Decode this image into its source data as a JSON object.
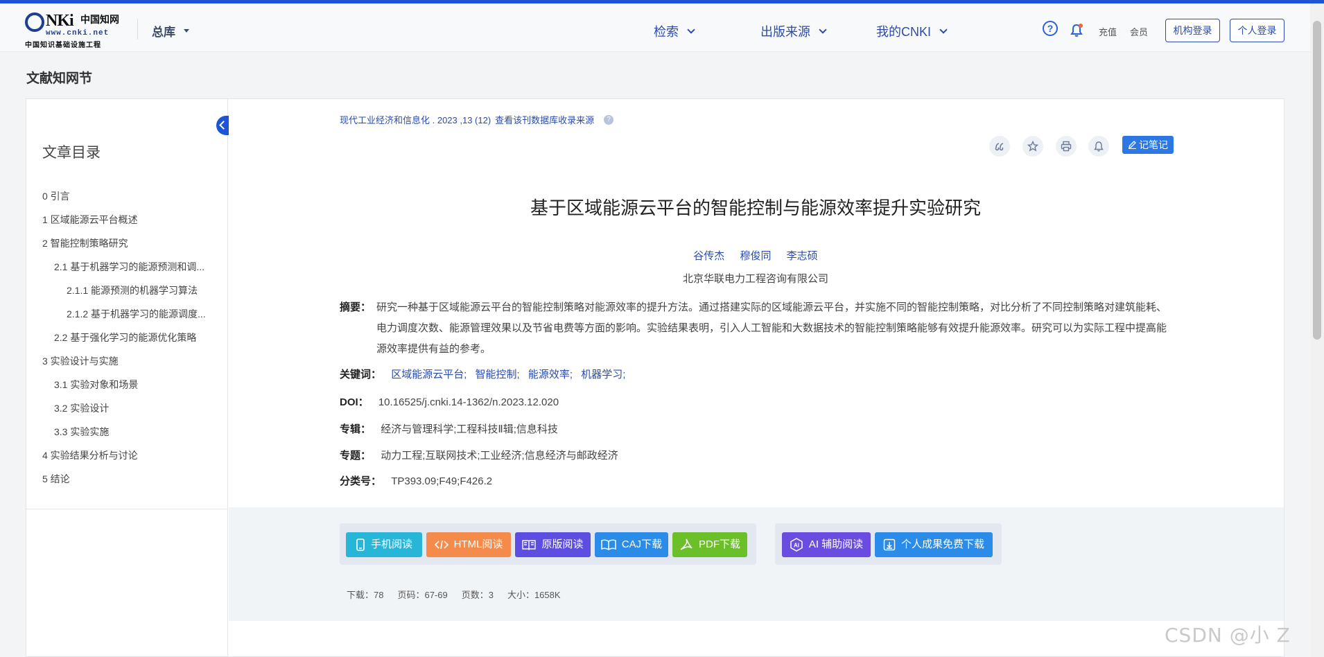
{
  "header": {
    "logo_text": "CNKi",
    "logo_cn": "中国知网",
    "logo_url": "www.cnki.net",
    "logo_sub": "中国知识基础设施工程",
    "db_select": "总库",
    "nav": [
      "检索",
      "出版来源",
      "我的CNKI"
    ],
    "help_icon": "?",
    "recharge": "充值",
    "member": "会员",
    "inst_login": "机构登录",
    "personal_login": "个人登录"
  },
  "section_title": "文献知网节",
  "toc": {
    "title": "文章目录",
    "items": [
      {
        "label": "0 引言",
        "level": 1
      },
      {
        "label": "1 区域能源云平台概述",
        "level": 1
      },
      {
        "label": "2 智能控制策略研究",
        "level": 1
      },
      {
        "label": "2.1 基于机器学习的能源预测和调...",
        "level": 2
      },
      {
        "label": "2.1.1 能源预测的机器学习算法",
        "level": 3
      },
      {
        "label": "2.1.2 基于机器学习的能源调度...",
        "level": 3
      },
      {
        "label": "2.2 基于强化学习的能源优化策略",
        "level": 2
      },
      {
        "label": "3 实验设计与实施",
        "level": 1
      },
      {
        "label": "3.1 实验对象和场景",
        "level": 2
      },
      {
        "label": "3.2 实验设计",
        "level": 2
      },
      {
        "label": "3.3 实验实施",
        "level": 2
      },
      {
        "label": "4 实验结果分析与讨论",
        "level": 1
      },
      {
        "label": "5 结论",
        "level": 1
      }
    ]
  },
  "article": {
    "source": "现代工业经济和信息化 .  2023 ,13 (12)",
    "source_link": "查看该刊数据库收录来源",
    "note_button": "记笔记",
    "title": "基于区域能源云平台的智能控制与能源效率提升实验研究",
    "authors": [
      "谷传杰",
      "穆俊同",
      "李志硕"
    ],
    "affiliation": "北京华联电力工程咨询有限公司",
    "abstract_label": "摘要：",
    "abstract": "研究一种基于区域能源云平台的智能控制策略对能源效率的提升方法。通过搭建实际的区域能源云平台，并实施不同的智能控制策略，对比分析了不同控制策略对建筑能耗、电力调度次数、能源管理效果以及节省电费等方面的影响。实验结果表明，引入人工智能和大数据技术的智能控制策略能够有效提升能源效率。研究可以为实际工程中提高能源效率提供有益的参考。",
    "keywords_label": "关键词：",
    "keywords": [
      "区域能源云平台;",
      "智能控制;",
      "能源效率;",
      "机器学习;"
    ],
    "doi_label": "DOI：",
    "doi": "10.16525/j.cnki.14-1362/n.2023.12.020",
    "series_label": "专辑：",
    "series": "经济与管理科学;工程科技Ⅱ辑;信息科技",
    "topic_label": "专题：",
    "topic": "动力工程;互联网技术;工业经济;信息经济与邮政经济",
    "class_label": "分类号：",
    "class_no": "TP393.09;F49;F426.2"
  },
  "actions": {
    "mobile": "手机阅读",
    "html": "HTML阅读",
    "original": "原版阅读",
    "caj": "CAJ下载",
    "pdf": "PDF下载",
    "ai": "AI 辅助阅读",
    "free": "个人成果免费下载"
  },
  "stats": {
    "downloads": "下载：78",
    "pages": "页码：67-69",
    "page_count": "页数：3",
    "size": "大小：1658K"
  },
  "watermark": "CSDN @小 Z",
  "colors": {
    "accent": "#1d55d8",
    "link": "#2b4bad",
    "mobile": "#27b5d8",
    "html": "#f58b4a",
    "original": "#5b4ee0",
    "caj": "#2b8be8",
    "pdf": "#6bbf28",
    "ai": "#6a4de0",
    "free": "#2b8be8"
  }
}
